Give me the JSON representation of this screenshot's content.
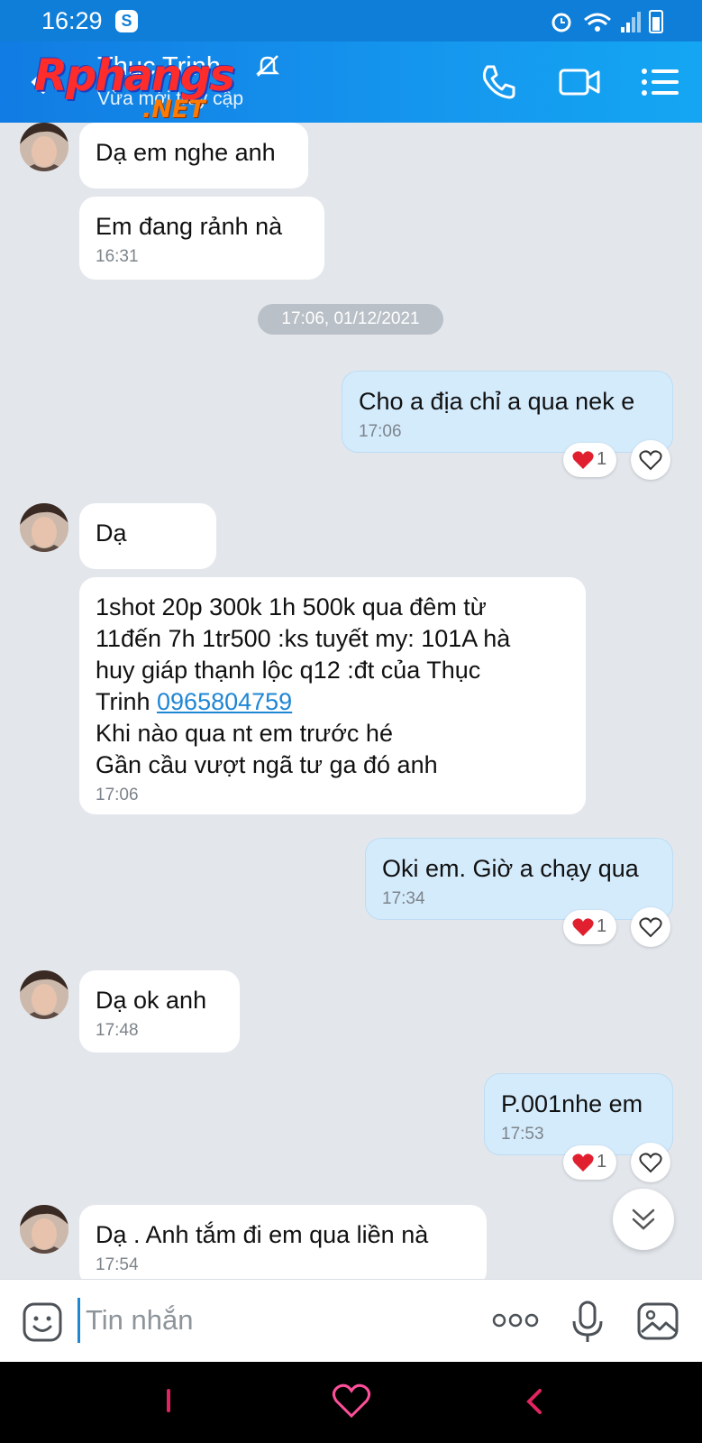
{
  "status_bar": {
    "time": "16:29",
    "s_badge": "S"
  },
  "header": {
    "contact_name": "Thuc Trinh",
    "contact_status": "Vừa mới truy cập",
    "watermark_main": "Rphangs",
    "watermark_sub": ".NET"
  },
  "messages": [
    {
      "dir": "in",
      "text": "Dạ em nghe anh"
    },
    {
      "dir": "in",
      "text": "Em đang rảnh nà",
      "time": "16:31"
    },
    {
      "dir": "out",
      "text": "Cho a địa chỉ a qua nek e",
      "time": "17:06",
      "reaction_count": "1"
    },
    {
      "dir": "in",
      "text": "Dạ"
    },
    {
      "dir": "in",
      "line1": "1shot 20p 300k 1h 500k qua đêm từ",
      "line2": "11đến 7h 1tr500 :ks tuyết my: 101A hà",
      "line3": "huy giáp thạnh lộc q12 :đt của Thục",
      "line4_prefix": "Trinh ",
      "phone": "0965804759",
      "line5": "Khi nào qua nt em trước hé",
      "line6": "Gần cầu vượt ngã tư ga đó anh",
      "time": "17:06"
    },
    {
      "dir": "out",
      "text": "Oki em. Giờ a chạy qua",
      "time": "17:34",
      "reaction_count": "1"
    },
    {
      "dir": "in",
      "text": "Dạ ok anh",
      "time": "17:48"
    },
    {
      "dir": "out",
      "text": "P.001nhe em",
      "time": "17:53",
      "reaction_count": "1"
    },
    {
      "dir": "in",
      "text": "Dạ . Anh tắm đi em qua liền nà",
      "time": "17:54"
    }
  ],
  "date_separator": "17:06, 01/12/2021",
  "input": {
    "placeholder": "Tin nhắn",
    "value": ""
  },
  "icons": [
    "back-icon",
    "bell-off-icon",
    "phone-icon",
    "video-icon",
    "menu-icon",
    "heart-icon",
    "chevron-down-icon",
    "sticker-icon",
    "more-icon",
    "mic-icon",
    "gallery-icon"
  ],
  "colors": {
    "header": "#1596ee",
    "out_bubble": "#d4ebfc",
    "in_bubble": "#ffffff",
    "background": "#e3e7ec",
    "link": "#1f86d4",
    "heart": "#e0202f"
  }
}
